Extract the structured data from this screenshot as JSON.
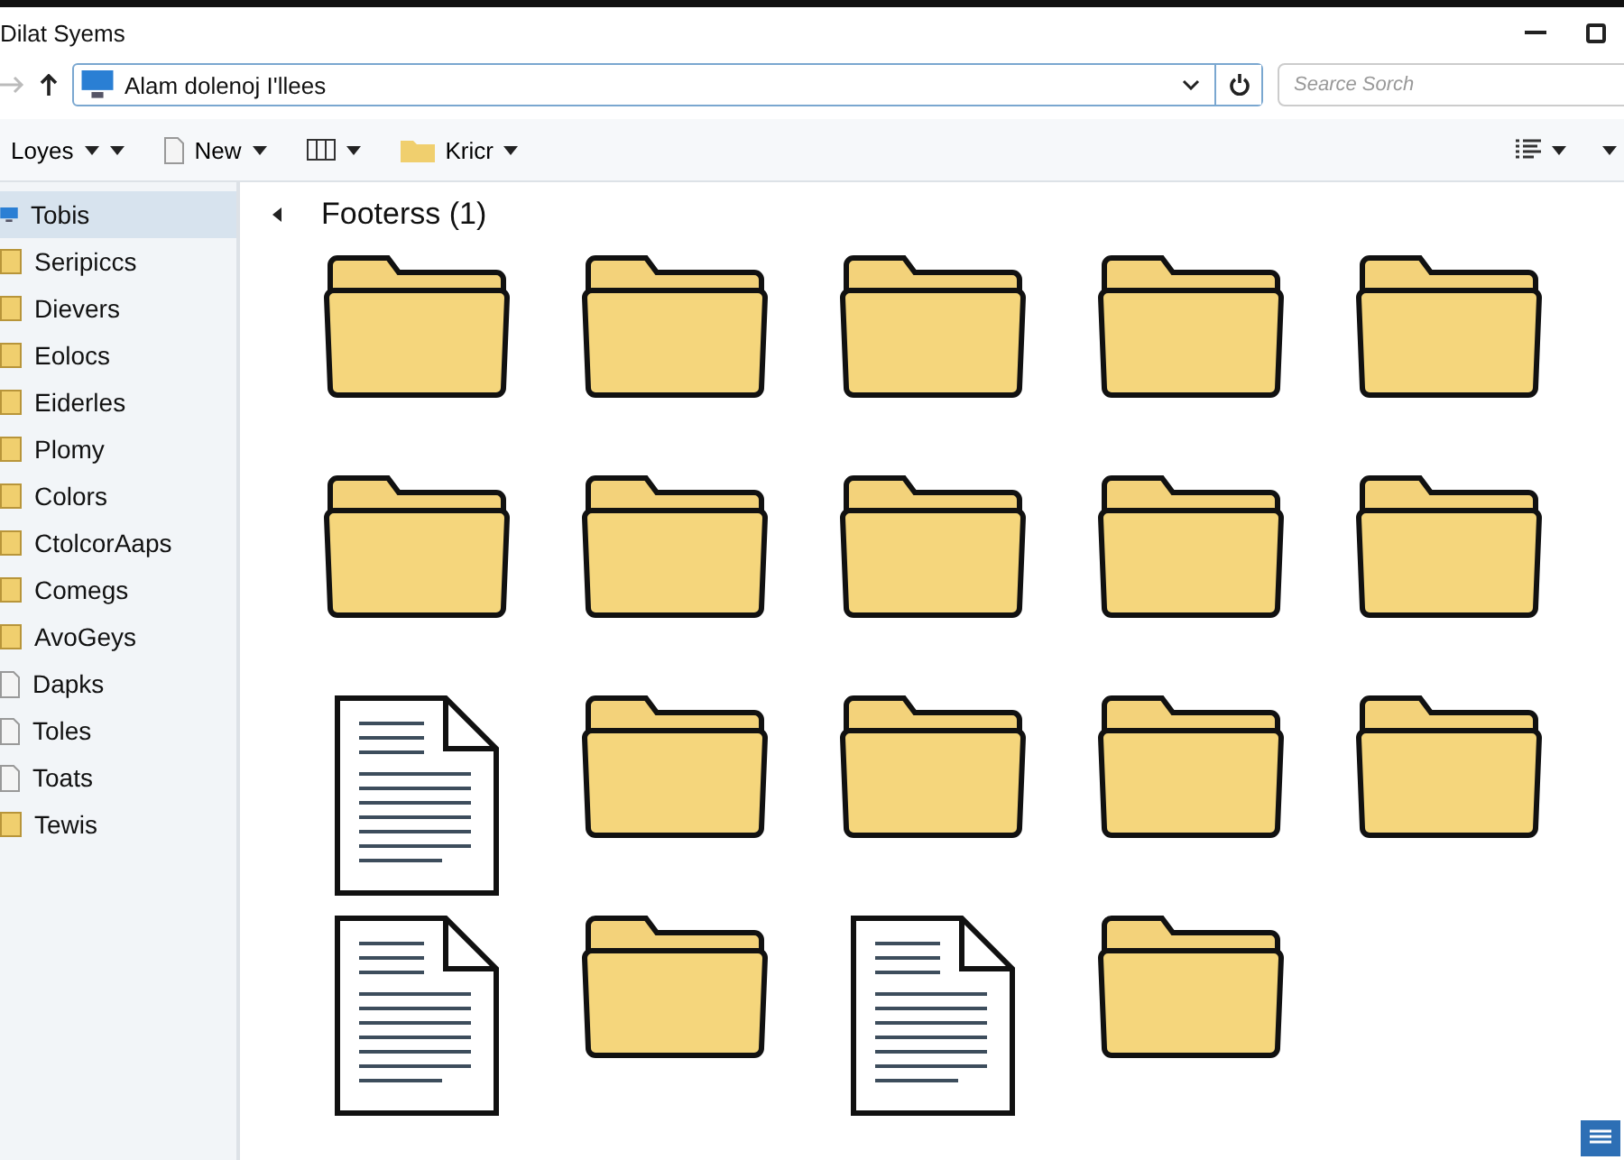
{
  "window": {
    "title": "Dilat Syems"
  },
  "address": {
    "path": "Alam dolenoj I'llees"
  },
  "search": {
    "placeholder": "Searce Sorch"
  },
  "toolbar": [
    {
      "kind": "menu",
      "label": "Loyes"
    },
    {
      "kind": "new",
      "label": "New"
    },
    {
      "kind": "view"
    },
    {
      "kind": "folder",
      "label": "Kricr"
    }
  ],
  "sidebar": {
    "items": [
      {
        "label": "Tobis",
        "kind": "computer",
        "selected": true
      },
      {
        "label": "Seripiccs",
        "kind": "folder",
        "selected": false
      },
      {
        "label": "Dievers",
        "kind": "folder",
        "selected": false
      },
      {
        "label": "Eolocs",
        "kind": "folder",
        "selected": false
      },
      {
        "label": "Eiderles",
        "kind": "folder",
        "selected": false
      },
      {
        "label": "Plomy",
        "kind": "folder",
        "selected": false
      },
      {
        "label": "Colors",
        "kind": "folder",
        "selected": false
      },
      {
        "label": "CtolcorAaps",
        "kind": "folder",
        "selected": false
      },
      {
        "label": "Comegs",
        "kind": "folder",
        "selected": false
      },
      {
        "label": "AvoGeys",
        "kind": "folder",
        "selected": false
      },
      {
        "label": "Dapks",
        "kind": "document",
        "selected": false
      },
      {
        "label": "Toles",
        "kind": "document",
        "selected": false
      },
      {
        "label": "Toats",
        "kind": "document",
        "selected": false
      },
      {
        "label": "Tewis",
        "kind": "folder",
        "selected": false
      }
    ]
  },
  "content": {
    "heading": "Footerss (1)",
    "items": [
      {
        "kind": "folder"
      },
      {
        "kind": "folder"
      },
      {
        "kind": "folder"
      },
      {
        "kind": "folder"
      },
      {
        "kind": "folder"
      },
      {
        "kind": "folder"
      },
      {
        "kind": "folder"
      },
      {
        "kind": "folder"
      },
      {
        "kind": "folder"
      },
      {
        "kind": "folder"
      },
      {
        "kind": "document"
      },
      {
        "kind": "folder"
      },
      {
        "kind": "folder"
      },
      {
        "kind": "folder"
      },
      {
        "kind": "folder"
      },
      {
        "kind": "document"
      },
      {
        "kind": "folder"
      },
      {
        "kind": "document"
      },
      {
        "kind": "folder"
      }
    ]
  }
}
